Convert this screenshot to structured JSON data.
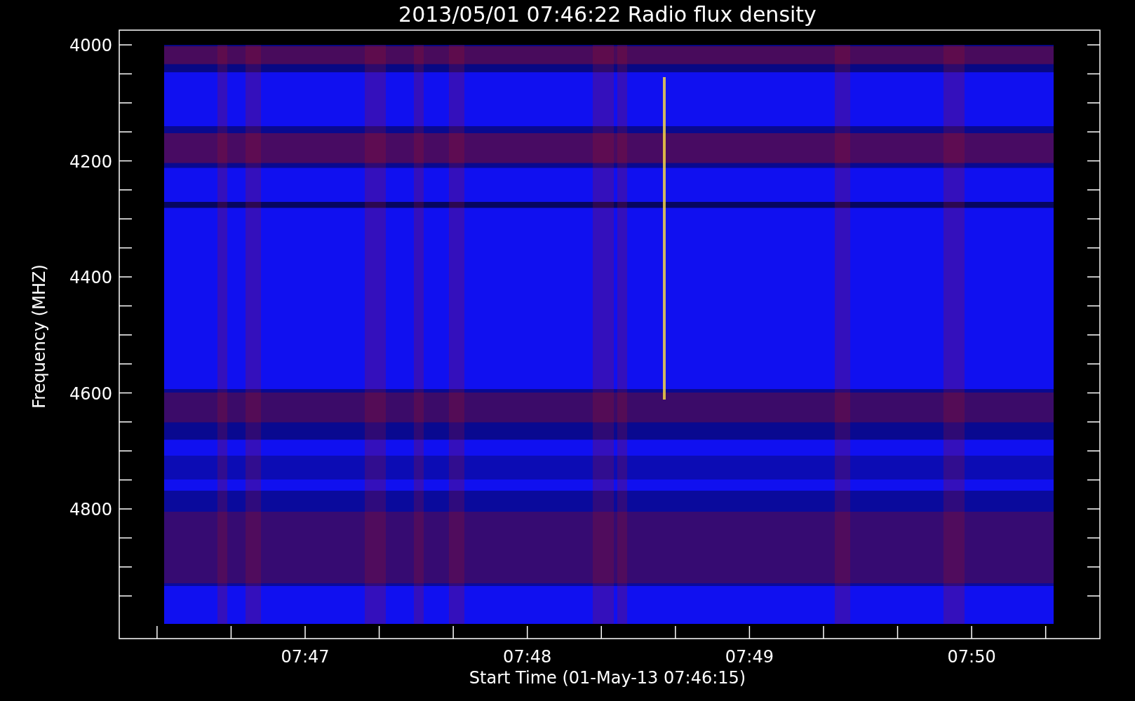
{
  "title": "2013/05/01 07:46:22 Radio flux density",
  "y_axis": {
    "label": "Frequency (MHZ)",
    "ticks": [
      "4000",
      "4200",
      "4400",
      "4600",
      "4800"
    ]
  },
  "x_axis": {
    "label": "Start Time (01-May-13 07:46:15)",
    "ticks": [
      "07:47",
      "07:48",
      "07:49",
      "07:50"
    ]
  }
}
